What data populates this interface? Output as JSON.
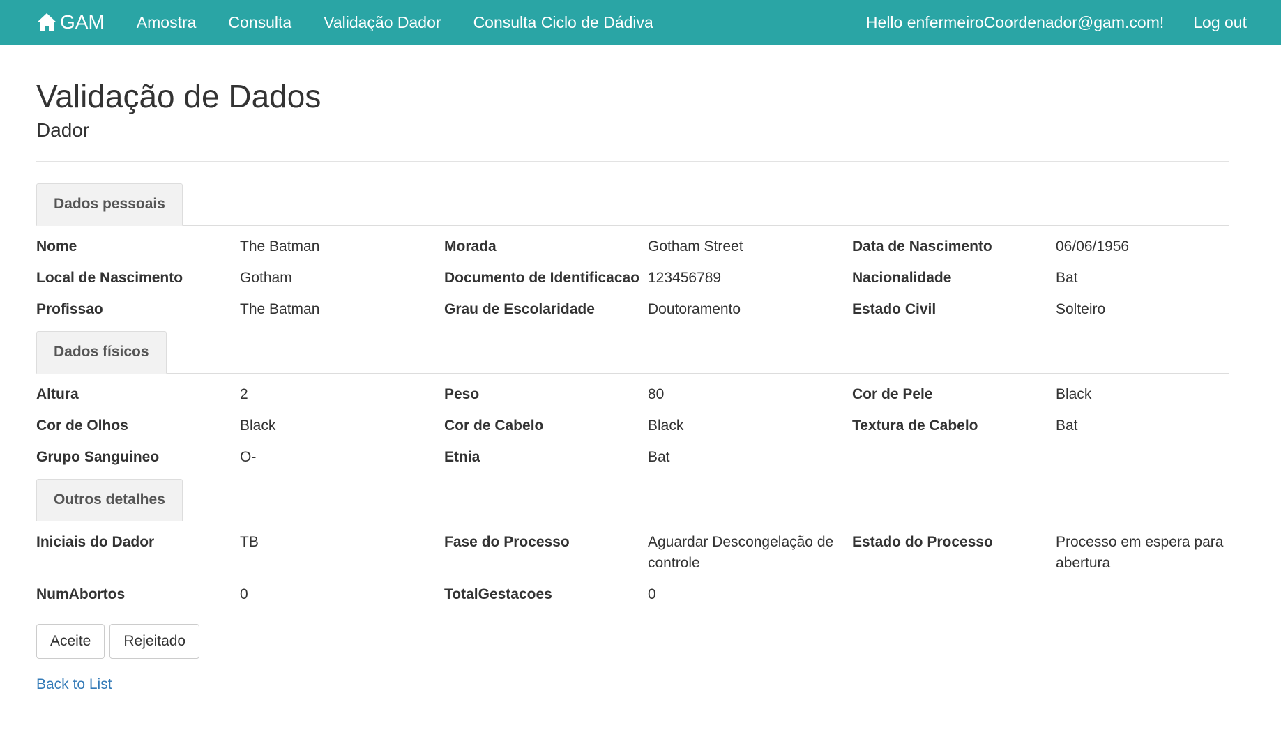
{
  "navbar": {
    "brand": "GAM",
    "links": [
      "Amostra",
      "Consulta",
      "Validação Dador",
      "Consulta Ciclo de Dádiva"
    ],
    "greeting": "Hello enfermeiroCoordenador@gam.com!",
    "logout": "Log out",
    "color": "#2aa5a5"
  },
  "page": {
    "title": "Validação de Dados",
    "subtitle": "Dador"
  },
  "sections": {
    "pessoais": {
      "tab": "Dados pessoais",
      "fields": [
        {
          "label": "Nome",
          "value": "The Batman"
        },
        {
          "label": "Morada",
          "value": "Gotham Street"
        },
        {
          "label": "Data de Nascimento",
          "value": "06/06/1956"
        },
        {
          "label": "Local de Nascimento",
          "value": "Gotham"
        },
        {
          "label": "Documento de Identificacao",
          "value": "123456789"
        },
        {
          "label": "Nacionalidade",
          "value": "Bat"
        },
        {
          "label": "Profissao",
          "value": "The Batman"
        },
        {
          "label": "Grau de Escolaridade",
          "value": "Doutoramento"
        },
        {
          "label": "Estado Civil",
          "value": "Solteiro"
        }
      ]
    },
    "fisicos": {
      "tab": "Dados físicos",
      "fields": [
        {
          "label": "Altura",
          "value": "2"
        },
        {
          "label": "Peso",
          "value": "80"
        },
        {
          "label": "Cor de Pele",
          "value": "Black"
        },
        {
          "label": "Cor de Olhos",
          "value": "Black"
        },
        {
          "label": "Cor de Cabelo",
          "value": "Black"
        },
        {
          "label": "Textura de Cabelo",
          "value": "Bat"
        },
        {
          "label": "Grupo Sanguineo",
          "value": "O-"
        },
        {
          "label": "Etnia",
          "value": "Bat"
        }
      ]
    },
    "outros": {
      "tab": "Outros detalhes",
      "fields": [
        {
          "label": "Iniciais do Dador",
          "value": "TB"
        },
        {
          "label": "Fase do Processo",
          "value": "Aguardar Descongelação de controle"
        },
        {
          "label": "Estado do Processo",
          "value": "Processo em espera para abertura"
        },
        {
          "label": "NumAbortos",
          "value": "0"
        },
        {
          "label": "TotalGestacoes",
          "value": "0"
        }
      ]
    }
  },
  "actions": {
    "accept": "Aceite",
    "reject": "Rejeitado",
    "back": "Back to List"
  },
  "icons": {
    "brand": "home-icon"
  }
}
